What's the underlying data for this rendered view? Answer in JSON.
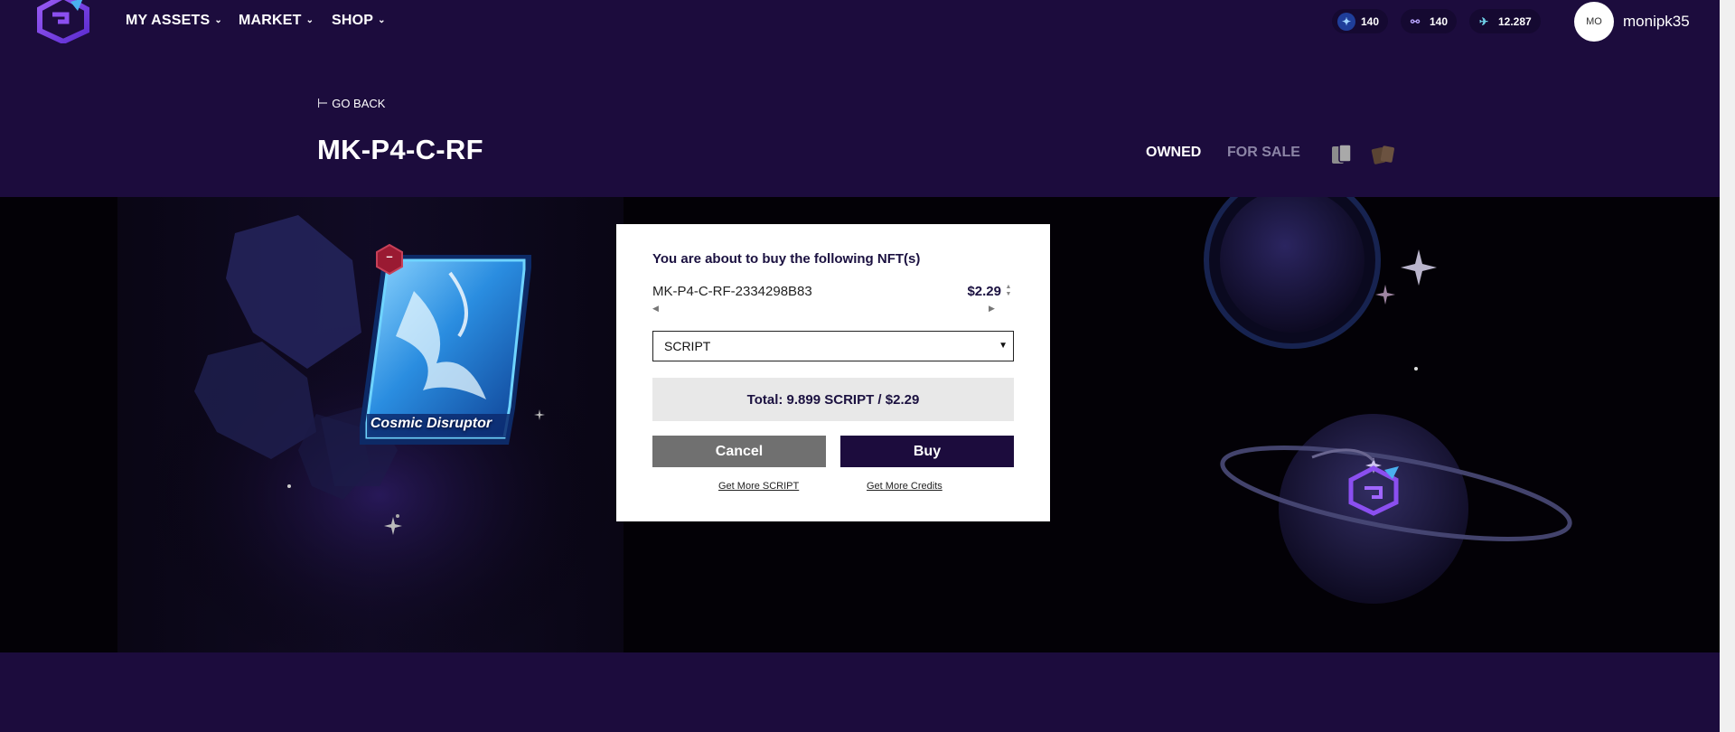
{
  "nav": {
    "items": [
      {
        "label": "MY ASSETS"
      },
      {
        "label": "MARKET"
      },
      {
        "label": "SHOP"
      }
    ],
    "balances": [
      {
        "icon": "energy-icon",
        "value": "140"
      },
      {
        "icon": "binoculars-icon",
        "value": "140"
      },
      {
        "icon": "ticket-icon",
        "value": "12.287"
      }
    ],
    "avatar_initials": "MO",
    "username": "monipk35"
  },
  "header": {
    "back_label": "GO BACK",
    "title": "MK-P4-C-RF",
    "tabs": [
      {
        "label": "OWNED",
        "active": true
      },
      {
        "label": "FOR SALE",
        "active": false
      }
    ]
  },
  "card": {
    "name": "Cosmic Disruptor",
    "badge": "–"
  },
  "modal": {
    "heading": "You are about to buy the following NFT(s)",
    "item_name": "MK-P4-C-RF-2334298B83",
    "item_price": "$2.29",
    "currency_selected": "SCRIPT",
    "total": "Total: 9.899 SCRIPT / $2.29",
    "cancel_label": "Cancel",
    "buy_label": "Buy",
    "link_script": "Get More SCRIPT",
    "link_credits": "Get More Credits"
  },
  "colors": {
    "background": "#1c0c3d",
    "scene": "#030106",
    "buy_button": "#1c0c3d",
    "cancel_button": "#707070",
    "total_box": "#e8e8e8"
  }
}
